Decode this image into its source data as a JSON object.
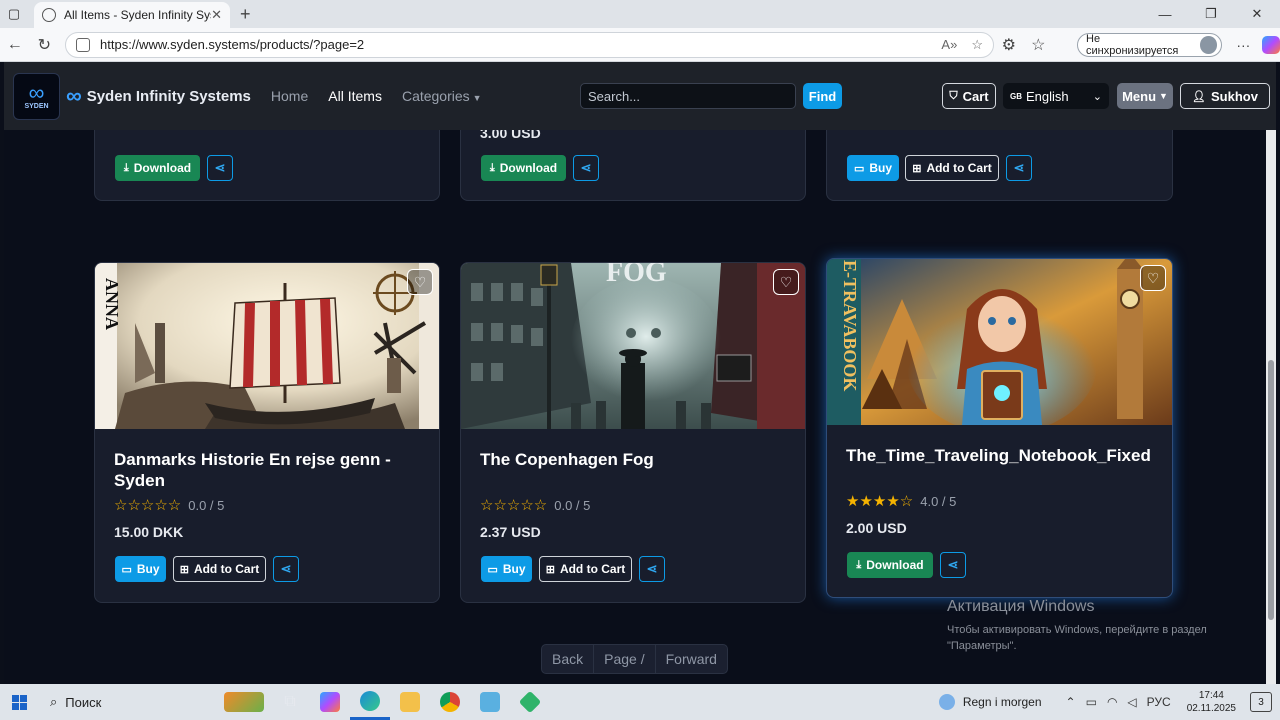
{
  "browser": {
    "tab_title": "All Items - Syden Infinity Systems",
    "url": "https://www.syden.systems/products/?page=2",
    "sync_label": "Не синхронизируется"
  },
  "navbar": {
    "logo_text": "SYDEN",
    "brand": "Syden Infinity Systems",
    "links": {
      "home": "Home",
      "all_items": "All Items",
      "categories": "Categories"
    },
    "search_placeholder": "Search...",
    "find_label": "Find",
    "cart_label": "Cart",
    "language_code": "GB",
    "language": "English",
    "menu_label": "Menu",
    "user_label": "Sukhov"
  },
  "top_cards": [
    {
      "price": "",
      "actions": [
        "Download"
      ]
    },
    {
      "price": "3.00 USD",
      "actions": [
        "Download"
      ]
    },
    {
      "price": "",
      "actions": [
        "Buy",
        "Add to Cart"
      ]
    }
  ],
  "products": [
    {
      "title": "Danmarks Historie En rejse genn - Syden",
      "rating": "0.0 / 5",
      "stars_filled": 0,
      "price": "15.00 DKK",
      "actions": [
        "Buy",
        "Add to Cart"
      ]
    },
    {
      "title": "The Copenhagen Fog",
      "rating": "0.0 / 5",
      "stars_filled": 0,
      "price": "2.37 USD",
      "actions": [
        "Buy",
        "Add to Cart"
      ]
    },
    {
      "title": "The_Time_Traveling_Notebook_Fixed",
      "rating": "4.0 / 5",
      "stars_filled": 4,
      "price": "2.00 USD",
      "actions": [
        "Download"
      ]
    }
  ],
  "labels": {
    "download": "Download",
    "buy": "Buy",
    "add_to_cart": "Add to Cart"
  },
  "pagination": {
    "back": "Back",
    "page": "Page /",
    "forward": "Forward"
  },
  "watermark": {
    "title": "Активация Windows",
    "text": "Чтобы активировать Windows, перейдите в раздел \"Параметры\"."
  },
  "taskbar": {
    "search_label": "Поиск",
    "weather": "Regn i morgen",
    "lang": "РУС",
    "time": "17:44",
    "date": "02.11.2025",
    "notifications": "3"
  }
}
